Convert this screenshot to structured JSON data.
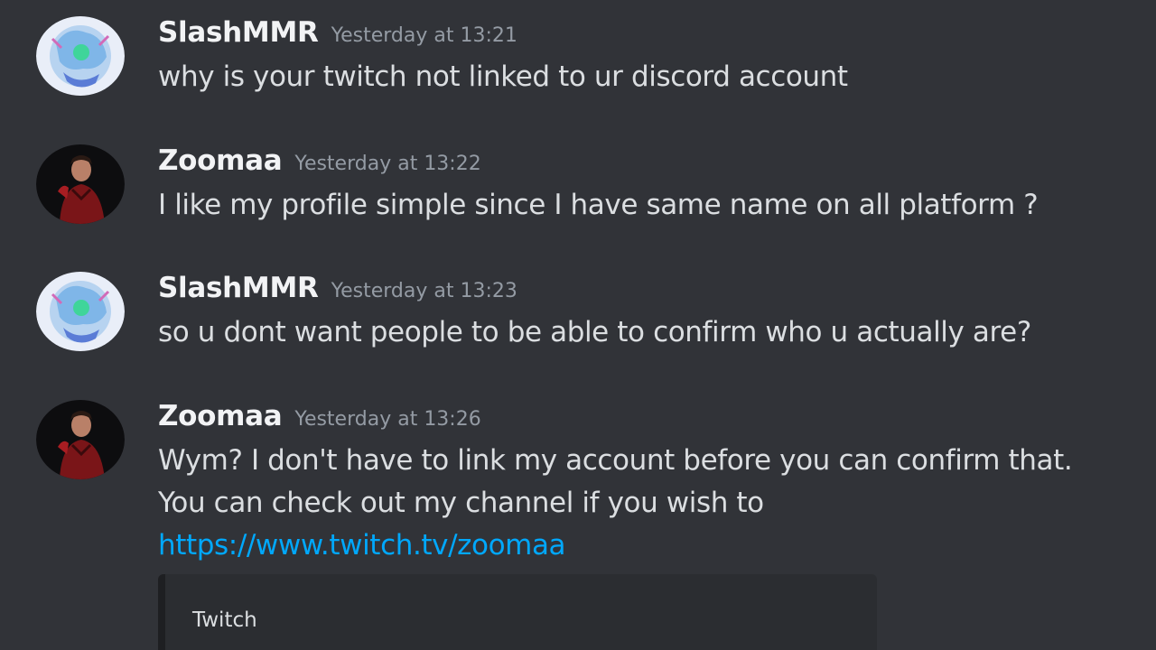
{
  "messages": [
    {
      "username": "SlashMMR",
      "timestamp": "Yesterday at 13:21",
      "lines": [
        "why is your twitch not linked to ur discord account"
      ],
      "avatar_icon": "anime-art-avatar-icon",
      "username_color": "#f2f3f5"
    },
    {
      "username": "Zoomaa",
      "timestamp": "Yesterday at 13:22",
      "lines": [
        "I like my profile simple since I have same name on all platform ?"
      ],
      "avatar_icon": "person-photo-avatar-icon",
      "username_color": "#f2f3f5"
    },
    {
      "username": "SlashMMR",
      "timestamp": "Yesterday at 13:23",
      "lines": [
        "so u dont want people to be able to confirm who u actually are?"
      ],
      "avatar_icon": "anime-art-avatar-icon",
      "username_color": "#f2f3f5"
    },
    {
      "username": "Zoomaa",
      "timestamp": "Yesterday at 13:26",
      "lines": [
        "Wym? I don't have to link my account before you can confirm that.",
        "You can check out my channel if you wish to"
      ],
      "link": "https://www.twitch.tv/zoomaa",
      "avatar_icon": "person-photo-avatar-icon",
      "username_color": "#f2f3f5"
    }
  ],
  "embed": {
    "provider": "Twitch"
  },
  "colors": {
    "background": "#313338",
    "text": "#dbdee1",
    "timestamp": "#949ba4",
    "link": "#00a8fc",
    "embed_bg": "#2b2d31"
  }
}
